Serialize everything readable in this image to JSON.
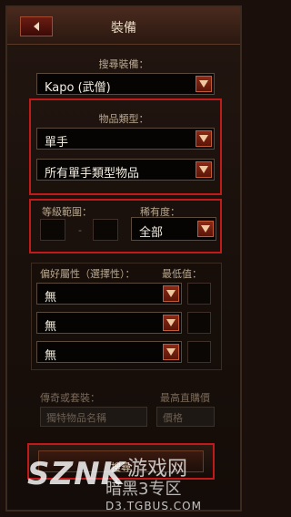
{
  "window": {
    "title": "裝備"
  },
  "recommend": {
    "label": "搜尋裝備：",
    "value": "Kapo (武僧)"
  },
  "item_type": {
    "label": "物品類型：",
    "type_value": "單手",
    "subtype_value": "所有單手類型物品"
  },
  "level": {
    "label": "等級範圍：",
    "separator": "-"
  },
  "rarity": {
    "label": "稀有度：",
    "value": "全部"
  },
  "affix": {
    "label": "偏好屬性（選擇性）：",
    "min_label": "最低值：",
    "rows": [
      {
        "value": "無"
      },
      {
        "value": "無"
      },
      {
        "value": "無"
      }
    ]
  },
  "legendary": {
    "label": "傳奇或套裝：",
    "placeholder": "獨特物品名稱"
  },
  "buyout": {
    "label": "最高直購價",
    "placeholder": "價格"
  },
  "search_button": {
    "label": "搜尋"
  },
  "watermark": {
    "brand": "SZNK",
    "site_cn": "游戏网",
    "title_cn": "暗黑3专区",
    "url": "D3.TGBUS.COM"
  },
  "colors": {
    "highlight": "#c01a1a",
    "dropdown": "#8a2a16",
    "text": "#f2ece0"
  },
  "icons": {
    "back": "arrow-left-icon",
    "dropdown": "triangle-down-icon"
  }
}
